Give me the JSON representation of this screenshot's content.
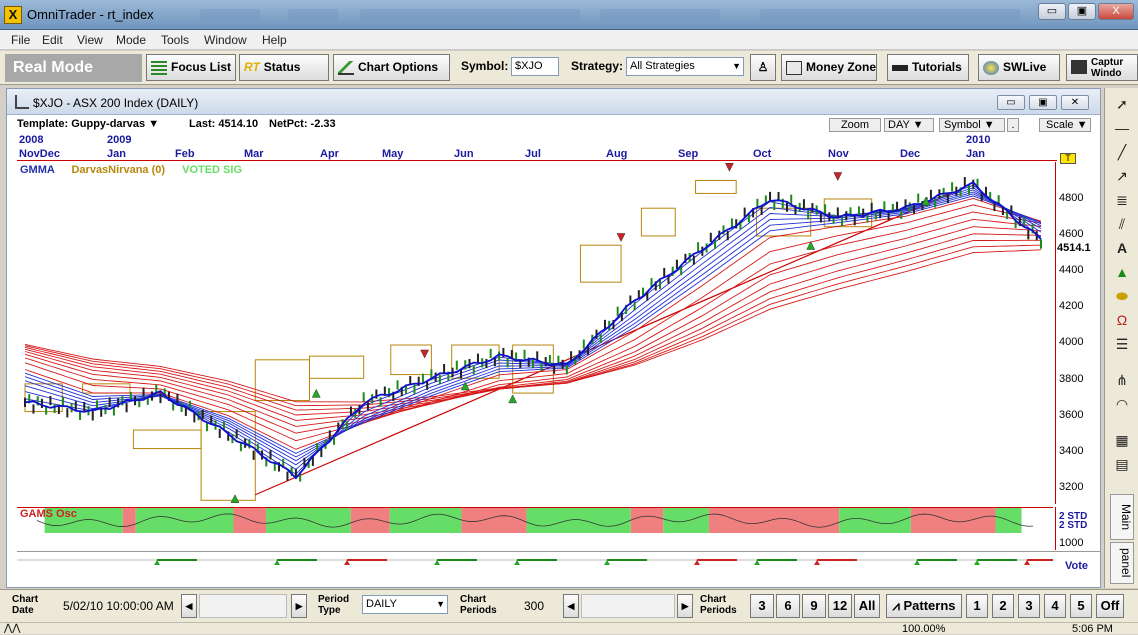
{
  "window": {
    "app_title": "OmniTrader - rt_index",
    "icon_glyph": "X",
    "minimize": "▭",
    "restore": "▣",
    "close": "X"
  },
  "menu": [
    "File",
    "Edit",
    "View",
    "Mode",
    "Tools",
    "Window",
    "Help"
  ],
  "toolbar": {
    "mode": "Real Mode",
    "focus_list": "Focus List",
    "status_prefix": "RT",
    "status": "Status",
    "chart_options": "Chart Options",
    "symbol_label": "Symbol:",
    "symbol_value": "$XJO",
    "strategy_label": "Strategy:",
    "strategy_value": "All Strategies",
    "money_zone": "Money Zone",
    "tutorials": "Tutorials",
    "swlive": "SWLive",
    "capture": "Captur\nWindo"
  },
  "chart_window": {
    "title": "$XJO - ASX 200 Index (DAILY)",
    "template": "Template: Guppy-darvas",
    "last": "Last: 4514.10",
    "netpct": "NetPct: -2.33",
    "zoom": "Zoom",
    "period": "DAY",
    "symbol_btn": "Symbol",
    "scale": "Scale",
    "years": {
      "y2008": "2008",
      "y2009": "2009",
      "y2010": "2010"
    },
    "months": [
      "NovDec",
      "Jan",
      "Feb",
      "Mar",
      "Apr",
      "May",
      "Jun",
      "Jul",
      "Aug",
      "Sep",
      "Oct",
      "Nov",
      "Dec",
      "Jan"
    ],
    "legend": {
      "gmma": "GMMA",
      "darvas": "DarvasNirvana (0)",
      "voted": "VOTED SIG"
    },
    "price_axis": [
      "4800",
      "4600",
      "4400",
      "4200",
      "4000",
      "3800",
      "3600",
      "3400",
      "3200"
    ],
    "last_price_tag": "4514.1",
    "flag": "T",
    "osc_label": "GAMS Osc",
    "osc_axis": [
      "2 STD",
      "2 STD",
      "1000"
    ],
    "vote": "Vote",
    "colors": {
      "grid_red": "#cc0000",
      "gmma_blue": "#1f2fd8",
      "gmma_red": "#d81818",
      "box": "#b8860b",
      "green": "#66dd66",
      "pink": "#f08080"
    }
  },
  "right_tabs": {
    "main": "Main",
    "panel": "panel"
  },
  "bottom": {
    "chart_date_label": "Chart\nDate",
    "chart_date": "5/02/10 10:00:00 AM",
    "period_type_label": "Period\nType",
    "period_type": "DAILY",
    "chart_periods_label": "Chart\nPeriods",
    "chart_periods": "300",
    "chart_periods_label2": "Chart\nPeriods",
    "period_buttons": [
      "3",
      "6",
      "9",
      "12",
      "All"
    ],
    "patterns": "Patterns",
    "pattern_buttons": [
      "1",
      "2",
      "3",
      "4",
      "5"
    ],
    "off": "Off"
  },
  "status": {
    "zoom": "100.00%",
    "time": "5:06 PM"
  },
  "chart_data": {
    "type": "line",
    "title": "$XJO - ASX 200 Index (DAILY)",
    "xlabel": "",
    "ylabel": "",
    "ylim": [
      3100,
      4950
    ],
    "x": [
      "2008-11",
      "2008-12",
      "2009-01",
      "2009-02",
      "2009-03",
      "2009-04",
      "2009-05",
      "2009-06",
      "2009-07",
      "2009-08",
      "2009-09",
      "2009-10",
      "2009-11",
      "2009-12",
      "2010-01",
      "2010-02"
    ],
    "series": [
      {
        "name": "GMMA",
        "values": [
          3650,
          3600,
          3700,
          3480,
          3250,
          3650,
          3780,
          3900,
          3850,
          4200,
          4480,
          4750,
          4650,
          4700,
          4830,
          4530
        ]
      }
    ],
    "trendline": {
      "from": [
        3150,
        "2009-03"
      ],
      "to": [
        4800,
        "2010-01"
      ]
    }
  }
}
